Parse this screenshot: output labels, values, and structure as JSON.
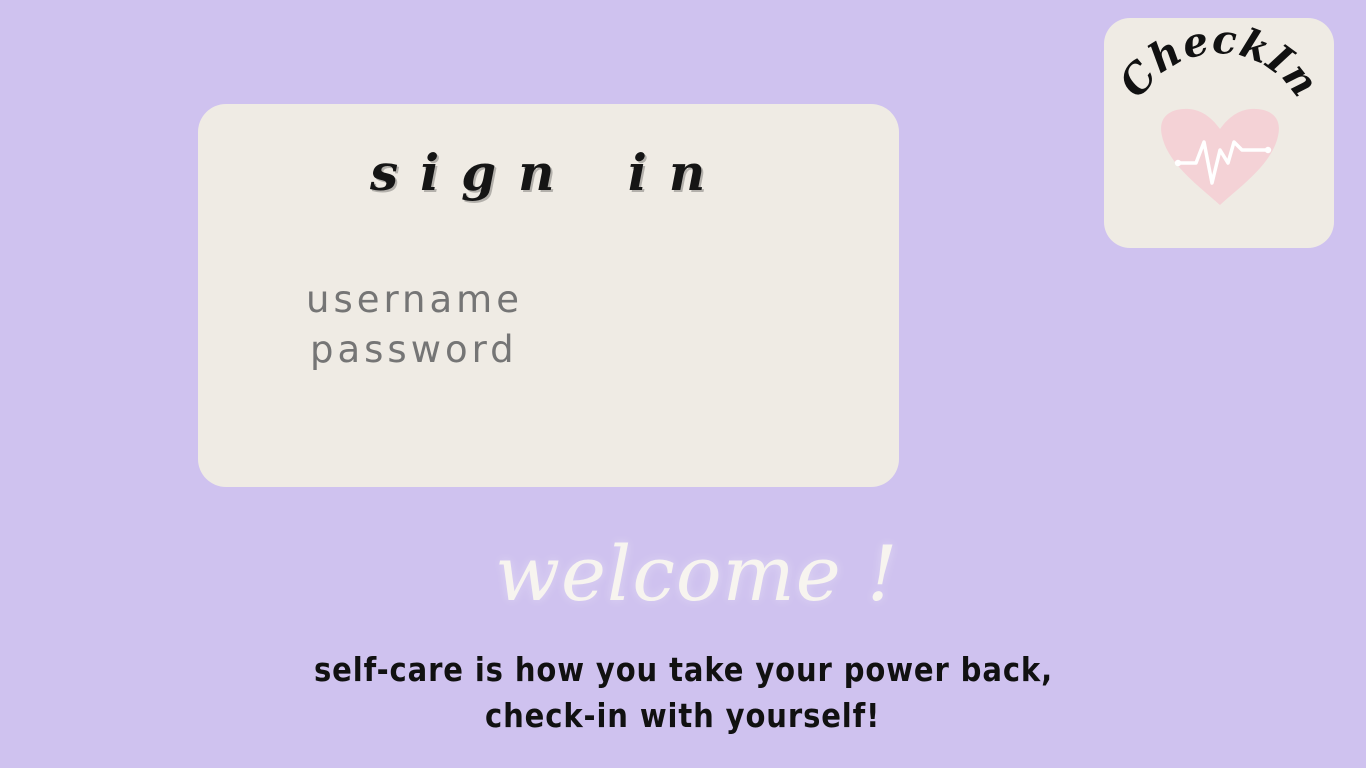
{
  "app": {
    "name": "CheckIn",
    "theme_colors": {
      "background": "#cfc2ef",
      "card": "#efebe4",
      "heart": "#f4d2d6",
      "text": "#111111",
      "welcome_text": "#f7f4ef"
    }
  },
  "signin": {
    "title": "sign in",
    "username_placeholder": "username",
    "password_placeholder": "password"
  },
  "logo": {
    "text": "CheckIn",
    "icon": "heart-pulse-icon"
  },
  "welcome": {
    "text": "welcome !"
  },
  "quote": {
    "line1": "self-care is how you take your power back,",
    "line2": "check-in with yourself!"
  }
}
